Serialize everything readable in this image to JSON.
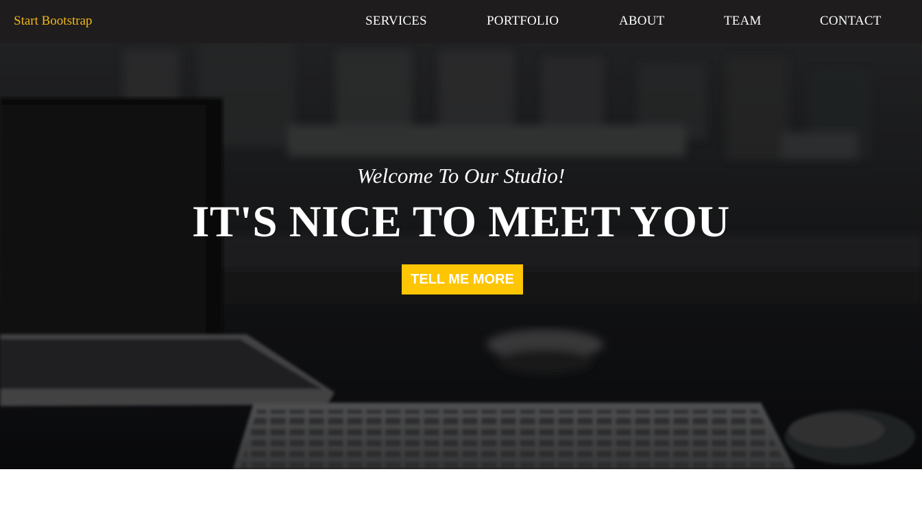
{
  "navbar": {
    "brand": "Start Bootstrap",
    "items": [
      {
        "label": "SERVICES"
      },
      {
        "label": "PORTFOLIO"
      },
      {
        "label": "ABOUT"
      },
      {
        "label": "TEAM"
      },
      {
        "label": "CONTACT"
      }
    ]
  },
  "hero": {
    "subheading": "Welcome To Our Studio!",
    "heading": "IT'S NICE TO MEET YOU",
    "button_label": "TELL ME MORE"
  },
  "colors": {
    "navbar_bg": "#1e1c1d",
    "brand": "#f2b81a",
    "accent": "#fec503",
    "text": "#ffffff"
  }
}
